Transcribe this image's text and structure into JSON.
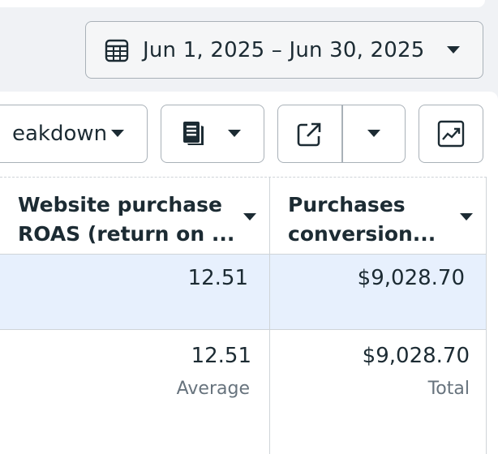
{
  "date_range": {
    "label": "Jun 1, 2025 – Jun 30, 2025",
    "icon": "calendar-icon"
  },
  "toolbar": {
    "breakdown_label": "eakdown",
    "reports_icon": "reports-icon",
    "export_icon": "export-icon",
    "chart_icon": "chart-trend-icon"
  },
  "table": {
    "columns": [
      {
        "line1": "Website purchase",
        "line2": "ROAS (return on ..."
      },
      {
        "line1": "Purchases",
        "line2": "conversion..."
      }
    ],
    "rows": [
      {
        "values": [
          "12.51",
          "$9,028.70"
        ]
      }
    ],
    "summary": {
      "values": [
        "12.51",
        "$9,028.70"
      ],
      "labels": [
        "Average",
        "Total"
      ]
    }
  },
  "colors": {
    "selected_row": "#e7f0fd",
    "border": "#a9b1b8",
    "text": "#1c2b33",
    "muted": "#67737d"
  }
}
